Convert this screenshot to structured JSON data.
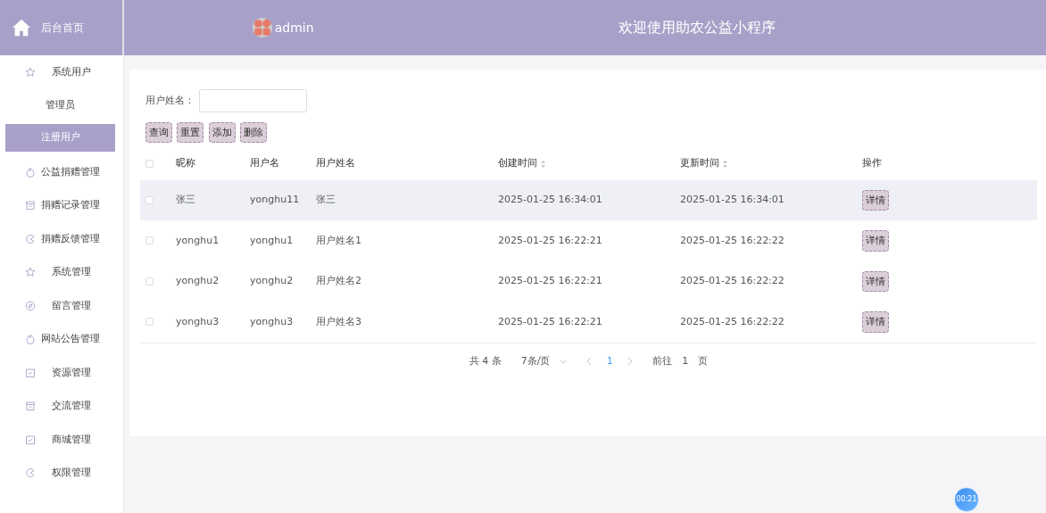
{
  "header": {
    "home_label": "后台首页",
    "user": "admin",
    "title": "欢迎使用助农公益小程序"
  },
  "sidebar": {
    "items": [
      {
        "label": "系统用户",
        "kind": "star",
        "children": [
          {
            "label": "管理员",
            "selected": false
          },
          {
            "label": "注册用户",
            "selected": true
          }
        ]
      },
      {
        "label": "公益捐赠管理",
        "kind": "flame"
      },
      {
        "label": "捐赠记录管理",
        "kind": "box"
      },
      {
        "label": "捐赠反馈管理",
        "kind": "pie"
      },
      {
        "label": "系统管理",
        "kind": "star"
      },
      {
        "label": "留言管理",
        "kind": "compass"
      },
      {
        "label": "网站公告管理",
        "kind": "flame"
      },
      {
        "label": "资源管理",
        "kind": "calendar"
      },
      {
        "label": "交流管理",
        "kind": "box"
      },
      {
        "label": "商城管理",
        "kind": "calendar"
      },
      {
        "label": "权限管理",
        "kind": "pie"
      }
    ]
  },
  "search": {
    "label": "用户姓名："
  },
  "buttons": [
    "查询",
    "重置",
    "添加",
    "删除"
  ],
  "table": {
    "all_checked": false,
    "columns": [
      {
        "label": "昵称",
        "kind": "plain"
      },
      {
        "label": "用户名",
        "kind": "plain"
      },
      {
        "label": "用户姓名",
        "kind": "plain"
      },
      {
        "label": "创建时间",
        "kind": "sortable"
      },
      {
        "label": "更新时间",
        "kind": "sortable"
      },
      {
        "label": "操作",
        "kind": "plain"
      }
    ],
    "rows": [
      {
        "hovered": true,
        "checked": false,
        "cells": [
          "张三",
          "yonghu11",
          "张三",
          "2025-01-25 16:34:01",
          "2025-01-25 16:34:01"
        ],
        "action": "详情"
      },
      {
        "hovered": false,
        "checked": false,
        "cells": [
          "yonghu1",
          "yonghu1",
          "用户姓名1",
          "2025-01-25 16:22:21",
          "2025-01-25 16:22:22"
        ],
        "action": "详情"
      },
      {
        "hovered": false,
        "checked": false,
        "cells": [
          "yonghu2",
          "yonghu2",
          "用户姓名2",
          "2025-01-25 16:22:21",
          "2025-01-25 16:22:22"
        ],
        "action": "详情"
      },
      {
        "hovered": false,
        "checked": false,
        "cells": [
          "yonghu3",
          "yonghu3",
          "用户姓名3",
          "2025-01-25 16:22:21",
          "2025-01-25 16:22:22"
        ],
        "action": "详情"
      }
    ]
  },
  "pagination": {
    "total": "共 4 条",
    "page_size": "7条/页",
    "pages": [
      {
        "label": "1",
        "selected": true
      }
    ],
    "goto_label": "前往",
    "goto_value": "1",
    "page_suffix": "页"
  },
  "timer": "00:21"
}
